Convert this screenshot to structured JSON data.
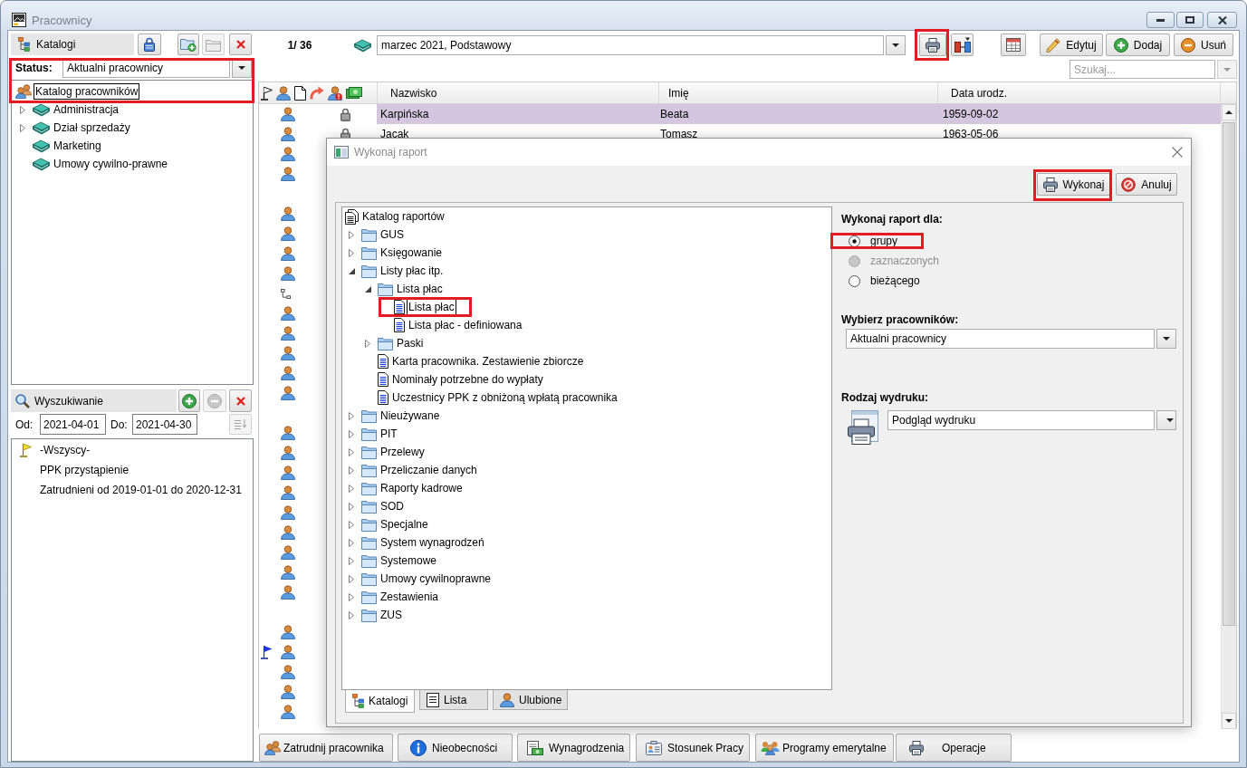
{
  "window": {
    "title": "Pracownicy"
  },
  "catalog_panel": {
    "title": "Katalogi",
    "buttons": [
      {
        "disabled": false
      },
      {
        "disabled": false
      },
      {
        "disabled": true
      },
      {
        "disabled": false
      }
    ],
    "highlighted": true,
    "status_label": "Status:",
    "status_value": "Aktualni pracownicy",
    "tree": [
      {
        "label": "Katalog pracowników",
        "selected": true,
        "children": [
          {
            "label": "Administracja",
            "expanded": false,
            "selected": false
          },
          {
            "label": "Dział sprzedaży",
            "expanded": false,
            "selected": false
          },
          {
            "label": "Marketing",
            "selected": false
          },
          {
            "label": "Umowy cywilno-prawne",
            "selected": false
          }
        ]
      }
    ]
  },
  "search_panel": {
    "title": "Wyszukiwanie",
    "buttons": [
      {
        "disabled": false
      },
      {
        "disabled": true
      },
      {
        "disabled": false
      }
    ],
    "from_label": "Od:",
    "from_value": "2021-04-01",
    "to_label": "Do:",
    "to_value": "2021-04-30",
    "apply_disabled": true,
    "items": [
      {
        "label": "-Wszyscy-",
        "flag": true
      },
      {
        "label": "PPK przystąpienie",
        "flag": false
      },
      {
        "label": "Zatrudnieni od 2019-01-01 do 2020-12-31",
        "flag": false
      }
    ]
  },
  "toolbar": {
    "counter": "1/ 36",
    "period": "marzec 2021, Podstawowy",
    "print_highlighted": true,
    "actions": [
      "Edytuj",
      "Dodaj",
      "Usuń"
    ],
    "search": {
      "placeholder": "Szukaj..."
    }
  },
  "table": {
    "columns": [
      "Nazwisko",
      "Imię",
      "Data urodz."
    ],
    "rows": [
      {
        "kind": "employee",
        "flag": false,
        "locked": true,
        "selected": true,
        "surname": "Karpińska",
        "first_name": "Beata",
        "birth_date": "1959-09-02"
      },
      {
        "kind": "employee",
        "flag": false,
        "locked": true,
        "selected": false,
        "surname": "Jacak",
        "first_name": "Tomasz",
        "birth_date": "1963-05-06"
      },
      {
        "kind": "employee",
        "flag": false,
        "selected": false
      },
      {
        "kind": "employee",
        "flag": false,
        "selected": false
      },
      {
        "kind": "blank",
        "flag": false,
        "selected": false
      },
      {
        "kind": "employee",
        "flag": false,
        "selected": false
      },
      {
        "kind": "employee",
        "flag": false,
        "selected": false
      },
      {
        "kind": "employee",
        "flag": false,
        "selected": false
      },
      {
        "kind": "employee",
        "flag": false,
        "selected": false
      },
      {
        "kind": "structure",
        "flag": false,
        "selected": false
      },
      {
        "kind": "employee",
        "flag": false,
        "selected": false
      },
      {
        "kind": "employee",
        "flag": false,
        "selected": false
      },
      {
        "kind": "employee",
        "flag": false,
        "selected": false
      },
      {
        "kind": "employee",
        "flag": false,
        "selected": false
      },
      {
        "kind": "employee",
        "flag": false,
        "selected": false
      },
      {
        "kind": "blank",
        "flag": false,
        "selected": false
      },
      {
        "kind": "employee",
        "flag": false,
        "selected": false
      },
      {
        "kind": "employee",
        "flag": false,
        "selected": false
      },
      {
        "kind": "employee",
        "flag": false,
        "selected": false
      },
      {
        "kind": "employee",
        "flag": false,
        "selected": false
      },
      {
        "kind": "employee",
        "flag": false,
        "selected": false
      },
      {
        "kind": "employee",
        "flag": false,
        "selected": false
      },
      {
        "kind": "employee",
        "flag": false,
        "selected": false
      },
      {
        "kind": "employee",
        "flag": false,
        "selected": false
      },
      {
        "kind": "employee",
        "flag": false,
        "selected": false
      },
      {
        "kind": "blank",
        "flag": false,
        "selected": false
      },
      {
        "kind": "employee",
        "flag": false,
        "selected": false
      },
      {
        "kind": "employee",
        "flag": true,
        "selected": false
      },
      {
        "kind": "employee",
        "flag": false,
        "selected": false
      },
      {
        "kind": "employee",
        "flag": false,
        "selected": false
      },
      {
        "kind": "employee",
        "flag": false,
        "selected": false
      }
    ]
  },
  "bottom_buttons": [
    "Zatrudnij pracownika",
    "Nieobecności",
    "Wynagrodzenia",
    "Stosunek Pracy",
    "Programy emerytalne",
    "Operacje"
  ],
  "dialog": {
    "title": "Wykonaj raport",
    "buttons": [
      {
        "label": "Wykonaj",
        "highlighted": true
      },
      {
        "label": "Anuluj",
        "highlighted": false
      }
    ],
    "tree": [
      {
        "label": "Katalog raportów",
        "kind": "root",
        "selected": false,
        "highlighted": false,
        "children": [
          {
            "label": "GUS",
            "kind": "folder",
            "expanded": false,
            "selected": false,
            "highlighted": false
          },
          {
            "label": "Księgowanie",
            "kind": "folder",
            "expanded": false,
            "selected": false,
            "highlighted": false
          },
          {
            "label": "Listy płac itp.",
            "kind": "folder",
            "expanded": true,
            "selected": false,
            "highlighted": false,
            "children": [
              {
                "label": "Lista płac",
                "kind": "folder",
                "expanded": true,
                "selected": false,
                "highlighted": false,
                "children": [
                  {
                    "label": "Lista płac",
                    "kind": "report",
                    "selected": true,
                    "highlighted": true
                  },
                  {
                    "label": "Lista płac - definiowana",
                    "kind": "report",
                    "selected": false,
                    "highlighted": false
                  }
                ]
              },
              {
                "label": "Paski",
                "kind": "folder",
                "expanded": false,
                "selected": false,
                "highlighted": false
              },
              {
                "label": "Karta pracownika. Zestawienie zbiorcze",
                "kind": "report",
                "selected": false,
                "highlighted": false
              },
              {
                "label": "Nominały potrzebne do wypłaty",
                "kind": "report",
                "selected": false,
                "highlighted": false
              },
              {
                "label": "Uczestnicy PPK z obniżoną wpłatą pracownika",
                "kind": "report",
                "selected": false,
                "highlighted": false
              }
            ]
          },
          {
            "label": "Nieużywane",
            "kind": "folder",
            "expanded": false,
            "selected": false,
            "highlighted": false
          },
          {
            "label": "PIT",
            "kind": "folder",
            "expanded": false,
            "selected": false,
            "highlighted": false
          },
          {
            "label": "Przelewy",
            "kind": "folder",
            "expanded": false,
            "selected": false,
            "highlighted": false
          },
          {
            "label": "Przeliczanie danych",
            "kind": "folder",
            "expanded": false,
            "selected": false,
            "highlighted": false
          },
          {
            "label": "Raporty kadrowe",
            "kind": "folder",
            "expanded": false,
            "selected": false,
            "highlighted": false
          },
          {
            "label": "SOD",
            "kind": "folder",
            "expanded": false,
            "selected": false,
            "highlighted": false
          },
          {
            "label": "Specjalne",
            "kind": "folder",
            "expanded": false,
            "selected": false,
            "highlighted": false
          },
          {
            "label": "System wynagrodzeń",
            "kind": "folder",
            "expanded": false,
            "selected": false,
            "highlighted": false
          },
          {
            "label": "Systemowe",
            "kind": "folder",
            "expanded": false,
            "selected": false,
            "highlighted": false
          },
          {
            "label": "Umowy cywilnoprawne",
            "kind": "folder",
            "expanded": false,
            "selected": false,
            "highlighted": false
          },
          {
            "label": "Zestawienia",
            "kind": "folder",
            "expanded": false,
            "selected": false,
            "highlighted": false
          },
          {
            "label": "ZUS",
            "kind": "folder",
            "expanded": false,
            "selected": false,
            "highlighted": false
          }
        ]
      }
    ],
    "tabs": [
      {
        "label": "Katalogi",
        "selected": true
      },
      {
        "label": "Lista",
        "selected": false
      },
      {
        "label": "Ulubione",
        "selected": false
      }
    ],
    "scope_label": "Wykonaj raport dla:",
    "scope_options": [
      {
        "label": "grupy",
        "selected": true,
        "disabled": false,
        "highlighted": true
      },
      {
        "label": "zaznaczonych",
        "selected": false,
        "disabled": true,
        "highlighted": false
      },
      {
        "label": "bieżącego",
        "selected": false,
        "disabled": false,
        "highlighted": false
      }
    ],
    "employees_label": "Wybierz pracowników:",
    "employees_value": "Aktualni pracownicy",
    "output_label": "Rodzaj wydruku:",
    "output_value": "Podgląd wydruku"
  }
}
